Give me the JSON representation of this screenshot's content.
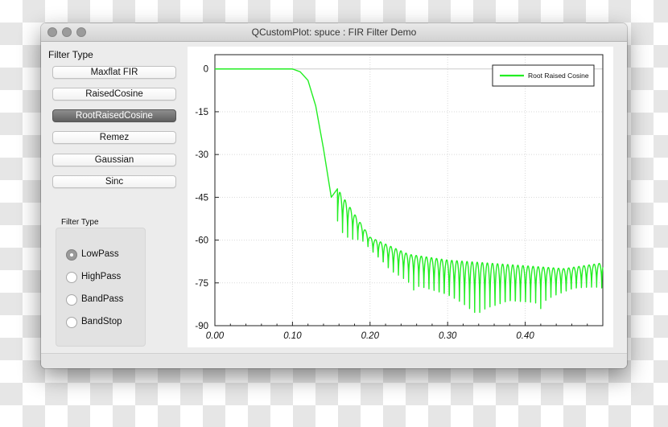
{
  "window": {
    "title": "QCustomPlot: spuce : FIR Filter Demo"
  },
  "filter_type_panel": {
    "title": "Filter Type",
    "buttons": [
      "Maxflat FIR",
      "RaisedCosine",
      "RootRaisedCosine",
      "Remez",
      "Gaussian",
      "Sinc"
    ],
    "selected": "RootRaisedCosine"
  },
  "band_panel": {
    "title": "Filter Type",
    "options": [
      "LowPass",
      "HighPass",
      "BandPass",
      "BandStop"
    ],
    "selected": "LowPass"
  },
  "colors": {
    "series": "#22ee22",
    "active_button": "#6f6f6f"
  },
  "chart_data": {
    "type": "line",
    "title": "",
    "xlabel": "",
    "ylabel": "",
    "xlim": [
      0,
      0.5
    ],
    "ylim": [
      -90,
      5
    ],
    "x_ticks": [
      "0.00",
      "0.10",
      "0.20",
      "0.30",
      "0.40"
    ],
    "y_ticks": [
      "0",
      "-15",
      "-30",
      "-45",
      "-60",
      "-75",
      "-90"
    ],
    "grid": true,
    "legend": {
      "position": "top-right",
      "entries": [
        "Root Raised Cosine"
      ]
    },
    "series": [
      {
        "name": "Root Raised Cosine",
        "color": "#22ee22",
        "x": [
          0.0,
          0.05,
          0.1,
          0.11,
          0.12,
          0.13,
          0.14,
          0.15,
          0.158,
          0.2,
          0.25,
          0.3,
          0.35,
          0.4,
          0.45,
          0.5
        ],
        "y": [
          0,
          0,
          0,
          -1,
          -4,
          -13,
          -28,
          -45,
          -42,
          -59,
          -65,
          -67,
          -68,
          -69,
          -70,
          -68
        ],
        "null_floor": [
          -60,
          -62,
          -74,
          -78,
          -84,
          -88,
          -88,
          -86,
          -83,
          -80,
          -78
        ]
      }
    ]
  }
}
